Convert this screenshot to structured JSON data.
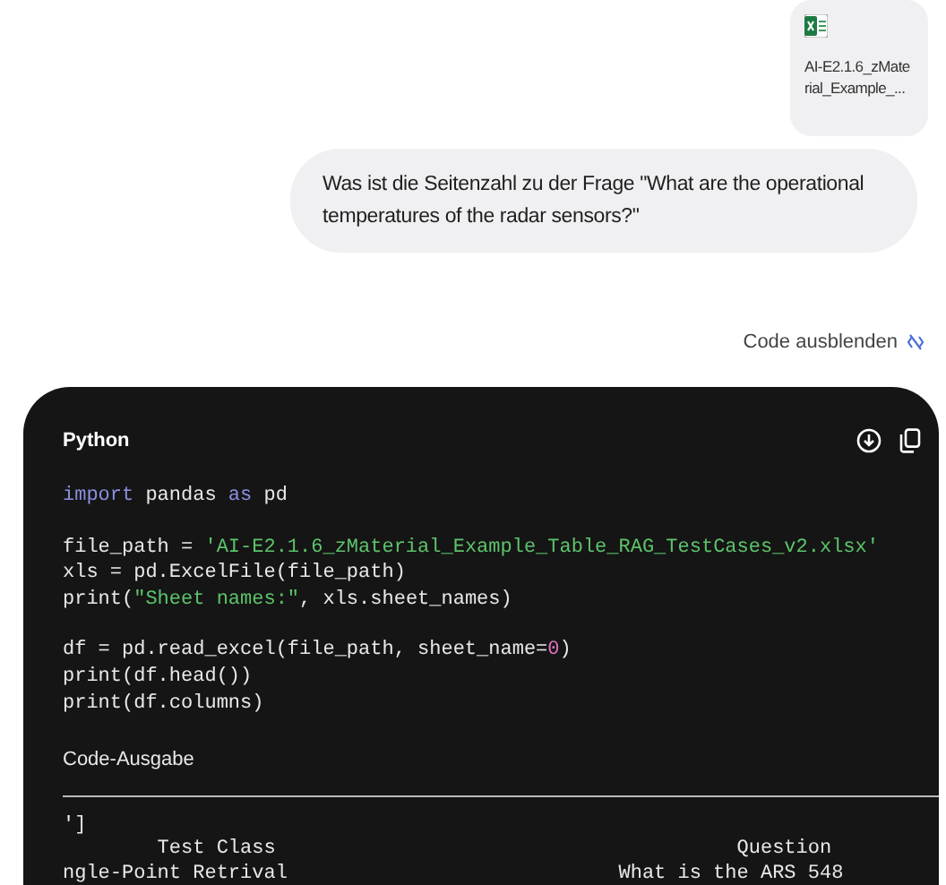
{
  "attachment": {
    "file_name": "AI-E2.1.6_zMaterial_Example_..."
  },
  "user_message": "Was ist die Seitenzahl zu der Frage \"What are the operational temperatures of the radar sensors?\"",
  "code_toggle": {
    "label": "Code ausblenden"
  },
  "code_block": {
    "language": "Python",
    "blocks": [
      [
        [
          {
            "kind": "keyword",
            "text": "import"
          },
          {
            "kind": "plain",
            "text": " pandas "
          },
          {
            "kind": "keyword",
            "text": "as"
          },
          {
            "kind": "plain",
            "text": " pd"
          }
        ]
      ],
      [
        [
          {
            "kind": "plain",
            "text": "file_path = "
          },
          {
            "kind": "string",
            "text": "'AI-E2.1.6_zMaterial_Example_Table_RAG_TestCases_v2.xlsx'"
          }
        ],
        [
          {
            "kind": "plain",
            "text": "xls = pd.ExcelFile(file_path)"
          }
        ],
        [
          {
            "kind": "plain",
            "text": "print("
          },
          {
            "kind": "string",
            "text": "\"Sheet names:\""
          },
          {
            "kind": "plain",
            "text": ", xls.sheet_names)"
          }
        ]
      ],
      [
        [
          {
            "kind": "plain",
            "text": "df = pd.read_excel(file_path, sheet_name="
          },
          {
            "kind": "number",
            "text": "0"
          },
          {
            "kind": "plain",
            "text": ")"
          }
        ],
        [
          {
            "kind": "plain",
            "text": "print(df.head())"
          }
        ],
        [
          {
            "kind": "plain",
            "text": "print(df.columns)"
          }
        ]
      ]
    ],
    "output_title": "Code-Ausgabe",
    "output_lines": [
      "']",
      "        Test Class                                       Question",
      "ngle-Point Retrival                            What is the ARS 548"
    ]
  }
}
